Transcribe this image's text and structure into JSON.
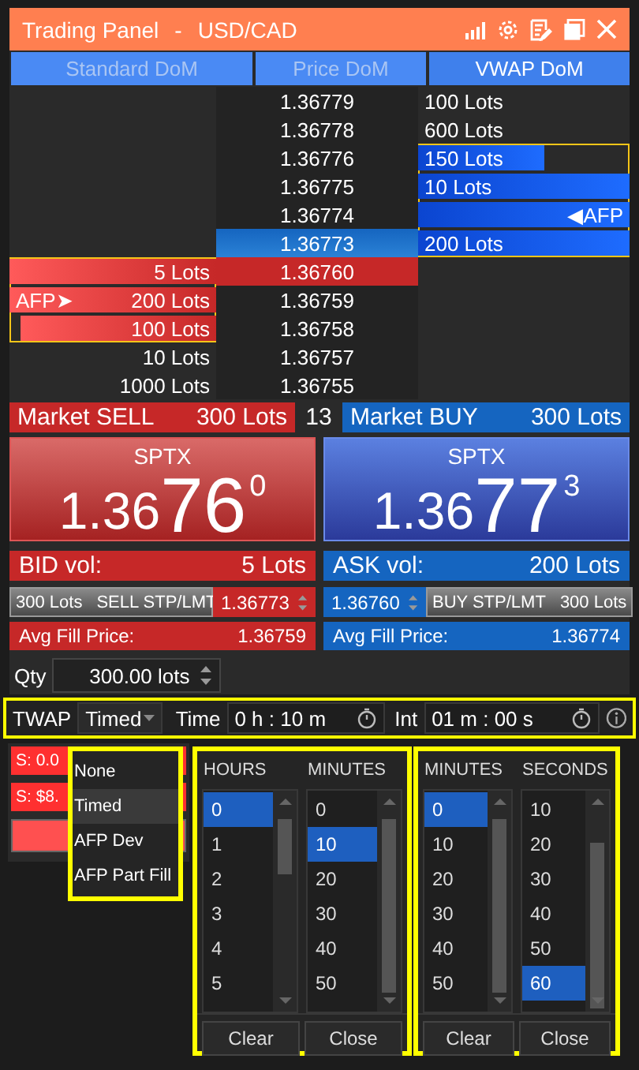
{
  "window": {
    "title": "Trading Panel",
    "separator": "-",
    "symbol": "USD/CAD"
  },
  "tabs": [
    {
      "label": "Standard DoM",
      "selected": false
    },
    {
      "label": "Price DoM",
      "selected": false
    },
    {
      "label": "VWAP DoM",
      "selected": true
    }
  ],
  "dom": {
    "rows": [
      {
        "price": "1.36779",
        "kind": "plain",
        "ask": {
          "lots": "100 Lots",
          "outlined": false
        }
      },
      {
        "price": "1.36778",
        "kind": "plain",
        "ask": {
          "lots": "600 Lots",
          "outlined": false
        }
      },
      {
        "price": "1.36776",
        "kind": "plain",
        "ask": {
          "lots": "150 Lots",
          "level": 0.6,
          "outlined": true
        }
      },
      {
        "price": "1.36775",
        "kind": "plain",
        "ask": {
          "lots": "10 Lots",
          "level": 1,
          "outlined": true
        }
      },
      {
        "price": "1.36774",
        "kind": "plain",
        "ask": {
          "tag": "◀AFP",
          "level": 1,
          "outlined": true
        }
      },
      {
        "price": "1.36773",
        "kind": "best_ask",
        "ask": {
          "lots": "200 Lots",
          "level": 1,
          "outlined": true
        }
      },
      {
        "price": "1.36760",
        "kind": "best_bid",
        "bid": {
          "lots": "5 Lots",
          "level": 1,
          "outlined": true
        }
      },
      {
        "price": "1.36759",
        "kind": "plain",
        "bid": {
          "tag": "AFP➤",
          "lots": "200 Lots",
          "level": 1,
          "outlined": true
        }
      },
      {
        "price": "1.36758",
        "kind": "plain",
        "bid": {
          "lots": "100 Lots",
          "level": 0.95,
          "outlined": true
        }
      },
      {
        "price": "1.36757",
        "kind": "plain",
        "bid": {
          "lots": "10 Lots",
          "outlined": false
        }
      },
      {
        "price": "1.36755",
        "kind": "plain",
        "bid": {
          "lots": "1000 Lots",
          "outlined": false
        }
      }
    ]
  },
  "market": {
    "sell": {
      "label": "Market SELL",
      "lots": "300 Lots"
    },
    "spread": "13",
    "buy": {
      "label": "Market BUY",
      "lots": "300 Lots"
    }
  },
  "quotes": [
    {
      "kind": "sell",
      "label": "SPTX",
      "prefix": "1.36",
      "big": "76",
      "pip": "0"
    },
    {
      "kind": "buy",
      "label": "SPTX",
      "prefix": "1.36",
      "big": "77",
      "pip": "3"
    }
  ],
  "volumes": [
    {
      "kind": "sell",
      "label": "BID vol:",
      "value": "5 Lots"
    },
    {
      "kind": "buy",
      "label": "ASK vol:",
      "value": "200 Lots"
    }
  ],
  "stop_orders": {
    "sell": {
      "lots": "300 Lots",
      "label": "SELL STP/LMT",
      "price": "1.36773"
    },
    "buy": {
      "price": "1.36760",
      "label": "BUY STP/LMT",
      "lots": "300 Lots"
    }
  },
  "avg_fill": [
    {
      "kind": "sell",
      "label": "Avg Fill Price:",
      "value": "1.36759"
    },
    {
      "kind": "buy",
      "label": "Avg Fill Price:",
      "value": "1.36774"
    }
  ],
  "qty": {
    "label": "Qty",
    "value": "300.00 lots"
  },
  "twap": {
    "label": "TWAP",
    "mode": "Timed",
    "time_label": "Time",
    "time_value": "0 h : 10 m",
    "int_label": "Int",
    "int_value": "01 m : 00 s"
  },
  "background_orders": [
    {
      "text": "S: 0.0"
    },
    {
      "text": "S: $8."
    }
  ],
  "mode_menu": [
    {
      "label": "None",
      "selected": false
    },
    {
      "label": "Timed",
      "selected": true
    },
    {
      "label": "AFP Dev",
      "selected": false
    },
    {
      "label": "AFP Part Fill",
      "selected": false
    }
  ],
  "pickers": [
    {
      "columns": [
        {
          "header": "HOURS",
          "items": [
            {
              "label": "0",
              "selected": true
            },
            {
              "label": "1",
              "selected": false
            },
            {
              "label": "2",
              "selected": false
            },
            {
              "label": "3",
              "selected": false
            },
            {
              "label": "4",
              "selected": false
            },
            {
              "label": "5",
              "selected": false
            }
          ]
        },
        {
          "header": "MINUTES",
          "items": [
            {
              "label": "0",
              "selected": false
            },
            {
              "label": "10",
              "selected": true
            },
            {
              "label": "20",
              "selected": false
            },
            {
              "label": "30",
              "selected": false
            },
            {
              "label": "40",
              "selected": false
            },
            {
              "label": "50",
              "selected": false
            }
          ]
        }
      ],
      "buttons": [
        "Clear",
        "Close"
      ]
    },
    {
      "columns": [
        {
          "header": "MINUTES",
          "items": [
            {
              "label": "0",
              "selected": true
            },
            {
              "label": "10",
              "selected": false
            },
            {
              "label": "20",
              "selected": false
            },
            {
              "label": "30",
              "selected": false
            },
            {
              "label": "40",
              "selected": false
            },
            {
              "label": "50",
              "selected": false
            }
          ]
        },
        {
          "header": "SECONDS",
          "items": [
            {
              "label": "10",
              "selected": false
            },
            {
              "label": "20",
              "selected": false
            },
            {
              "label": "30",
              "selected": false
            },
            {
              "label": "40",
              "selected": false
            },
            {
              "label": "50",
              "selected": false
            },
            {
              "label": "60",
              "selected": true
            }
          ]
        }
      ],
      "buttons": [
        "Clear",
        "Close"
      ]
    }
  ]
}
